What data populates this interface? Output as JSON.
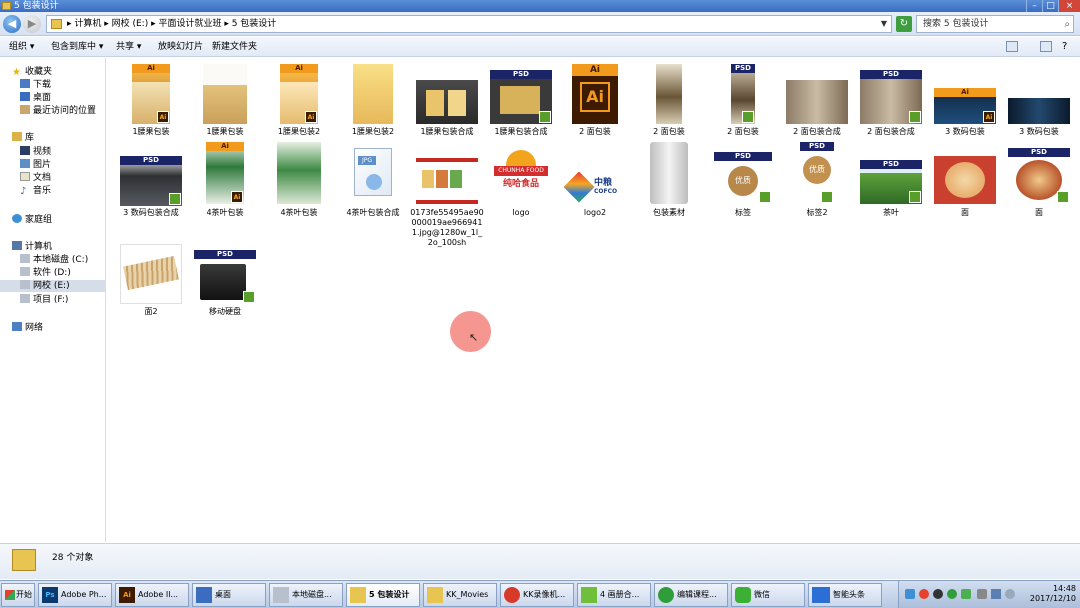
{
  "window": {
    "title": "5 包装设计",
    "controls": [
      "–",
      "□",
      "×"
    ]
  },
  "address": {
    "crumbs": "▸ 计算机 ▸ 网校 (E:) ▸ 平面设计就业班 ▸ 5 包装设计",
    "search_placeholder": "搜索 5 包装设计"
  },
  "toolbar": {
    "organize": "组织 ▾",
    "include": "包含到库中 ▾",
    "share": "共享 ▾",
    "slideshow": "放映幻灯片",
    "new_folder": "新建文件夹"
  },
  "sidebar": {
    "favorites": "收藏夹",
    "downloads": "下载",
    "desktop": "桌面",
    "recent": "最近访问的位置",
    "libraries": "库",
    "videos": "视频",
    "pictures": "图片",
    "documents": "文档",
    "music": "音乐",
    "homegroup": "家庭组",
    "computer": "计算机",
    "drive_c": "本地磁盘 (C:)",
    "drive_d": "软件 (D:)",
    "drive_e": "网校 (E:)",
    "drive_f": "项目 (F:)",
    "network": "网络"
  },
  "files": [
    {
      "name": "1腰果包装",
      "kind": "ai-nuts"
    },
    {
      "name": "1腰果包装",
      "kind": "nuts"
    },
    {
      "name": "1腰果包装2",
      "kind": "ai-nuts"
    },
    {
      "name": "1腰果包装2",
      "kind": "nuts-girl"
    },
    {
      "name": "1腰果包装合成",
      "kind": "photo-dark"
    },
    {
      "name": "1腰果包装合成",
      "kind": "psd-dark"
    },
    {
      "name": "2 面包装",
      "kind": "ai-file"
    },
    {
      "name": "2 面包装",
      "kind": "bag"
    },
    {
      "name": "2 面包装",
      "kind": "psd-bag"
    },
    {
      "name": "2 面包装合成",
      "kind": "photo-room"
    },
    {
      "name": "2 面包装合成",
      "kind": "psd-room"
    },
    {
      "name": "3 数码包装",
      "kind": "ai-dark"
    },
    {
      "name": "3 数码包装",
      "kind": "dark-blue"
    },
    {
      "name": "3 数码包装合成",
      "kind": "psd-digital"
    },
    {
      "name": "4茶叶包装",
      "kind": "ai-tea"
    },
    {
      "name": "4茶叶包装",
      "kind": "tea"
    },
    {
      "name": "4茶叶包装合成",
      "kind": "jpg-file"
    },
    {
      "name": "0173fe55495ae90000019ae9669411.jpg@1280w_1l_2o_100sh",
      "kind": "food-photo"
    },
    {
      "name": "logo",
      "kind": "logo-chunha"
    },
    {
      "name": "logo2",
      "kind": "logo-cofco"
    },
    {
      "name": "包装素材",
      "kind": "blank-bag"
    },
    {
      "name": "标签",
      "kind": "psd-label"
    },
    {
      "name": "标签2",
      "kind": "psd-label2"
    },
    {
      "name": "茶叶",
      "kind": "psd-tea-field"
    },
    {
      "name": "面",
      "kind": "noodle"
    },
    {
      "name": "面",
      "kind": "psd-noodle"
    },
    {
      "name": "面2",
      "kind": "sticks"
    },
    {
      "name": "移动硬盘",
      "kind": "psd-hdd"
    }
  ],
  "thumb_text": {
    "psd": "PSD",
    "ai": "Ai",
    "jpg": "JPG",
    "chunha_top": "CHUNHA FOOD",
    "chunha_cn": "纯哈食品",
    "cofco_cn": "中粮",
    "cofco_en": "COFCO",
    "label_cn": "优质"
  },
  "status": {
    "count": "28 个对象"
  },
  "taskbar": {
    "start": "开始",
    "items": [
      "Adobe Ph...",
      "Adobe Il...",
      "桌面",
      "本地磁盘...",
      "5 包装设计",
      "KK_Movies",
      "KK录像机...",
      "4 画册合...",
      "编辑课程...",
      "微信",
      "智能头条"
    ],
    "time": "14:48",
    "date": "2017/12/10"
  }
}
